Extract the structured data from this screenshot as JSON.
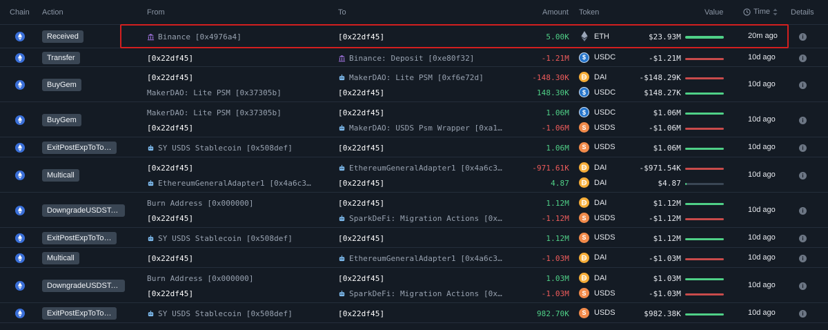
{
  "header": {
    "chain": "Chain",
    "action": "Action",
    "from": "From",
    "to": "To",
    "amount": "Amount",
    "token": "Token",
    "value": "Value",
    "time": "Time",
    "details": "Details"
  },
  "colors": {
    "background": "#141b24",
    "positive": "#4fd087",
    "negative": "#ef5b5b",
    "highlight": "#d41f1f",
    "badge": "#3a4654"
  },
  "rows": [
    {
      "action": "Received",
      "time": "20m ago",
      "lines": [
        {
          "from": "Binance [0x4976a4]",
          "from_icon": "bank-icon",
          "to": "[0x22df45]",
          "to_icon": "",
          "amount": "5.00K",
          "dir": "pos",
          "token": "ETH",
          "token_icon": "eth-icon",
          "value": "$23.93M",
          "level": 1.0
        }
      ]
    },
    {
      "action": "Transfer",
      "time": "10d ago",
      "lines": [
        {
          "from": "[0x22df45]",
          "from_icon": "",
          "to": "Binance: Deposit [0xe80f32]",
          "to_icon": "bank-icon",
          "amount": "-1.21M",
          "dir": "neg",
          "token": "USDC",
          "token_icon": "usdc-icon",
          "value": "-$1.21M",
          "level": 1.0
        }
      ]
    },
    {
      "action": "BuyGem",
      "time": "10d ago",
      "lines": [
        {
          "from": "[0x22df45]",
          "from_icon": "",
          "to": "MakerDAO: Lite PSM [0xf6e72d]",
          "to_icon": "bot-icon",
          "amount": "-148.30K",
          "dir": "neg",
          "token": "DAI",
          "token_icon": "dai-icon",
          "value": "-$148.29K",
          "level": 1.0
        },
        {
          "from": "MakerDAO: Lite PSM [0x37305b]",
          "from_icon": "",
          "to": "[0x22df45]",
          "to_icon": "",
          "amount": "148.30K",
          "dir": "pos",
          "token": "USDC",
          "token_icon": "usdc-icon",
          "value": "$148.27K",
          "level": 1.0
        }
      ]
    },
    {
      "action": "BuyGem",
      "time": "10d ago",
      "lines": [
        {
          "from": "MakerDAO: Lite PSM [0x37305b]",
          "from_icon": "",
          "to": "[0x22df45]",
          "to_icon": "",
          "amount": "1.06M",
          "dir": "pos",
          "token": "USDC",
          "token_icon": "usdc-icon",
          "value": "$1.06M",
          "level": 1.0
        },
        {
          "from": "[0x22df45]",
          "from_icon": "",
          "to": "MakerDAO: USDS Psm Wrapper [0xa1…",
          "to_icon": "bot-icon",
          "amount": "-1.06M",
          "dir": "neg",
          "token": "USDS",
          "token_icon": "usds-icon",
          "value": "-$1.06M",
          "level": 1.0
        }
      ]
    },
    {
      "action": "ExitPostExpToTo…",
      "time": "10d ago",
      "lines": [
        {
          "from": "SY USDS Stablecoin [0x508def]",
          "from_icon": "bot-icon",
          "to": "[0x22df45]",
          "to_icon": "",
          "amount": "1.06M",
          "dir": "pos",
          "token": "USDS",
          "token_icon": "usds-icon",
          "value": "$1.06M",
          "level": 1.0
        }
      ]
    },
    {
      "action": "Multicall",
      "time": "10d ago",
      "lines": [
        {
          "from": "[0x22df45]",
          "from_icon": "",
          "to": "EthereumGeneralAdapter1 [0x4a6c3…",
          "to_icon": "bot-icon",
          "amount": "-971.61K",
          "dir": "neg",
          "token": "DAI",
          "token_icon": "dai-icon",
          "value": "-$971.54K",
          "level": 1.0
        },
        {
          "from": "EthereumGeneralAdapter1 [0x4a6c3…",
          "from_icon": "bot-icon",
          "to": "[0x22df45]",
          "to_icon": "",
          "amount": "4.87",
          "dir": "pos",
          "token": "DAI",
          "token_icon": "dai-icon",
          "value": "$4.87",
          "level": 0.0
        }
      ]
    },
    {
      "action": "DowngradeUSDSTo…",
      "time": "10d ago",
      "lines": [
        {
          "from": "Burn Address [0x000000]",
          "from_icon": "",
          "to": "[0x22df45]",
          "to_icon": "",
          "amount": "1.12M",
          "dir": "pos",
          "token": "DAI",
          "token_icon": "dai-icon",
          "value": "$1.12M",
          "level": 1.0
        },
        {
          "from": "[0x22df45]",
          "from_icon": "",
          "to": "SparkDeFi: Migration Actions [0x…",
          "to_icon": "bot-icon",
          "amount": "-1.12M",
          "dir": "neg",
          "token": "USDS",
          "token_icon": "usds-icon",
          "value": "-$1.12M",
          "level": 1.0
        }
      ]
    },
    {
      "action": "ExitPostExpToTo…",
      "time": "10d ago",
      "lines": [
        {
          "from": "SY USDS Stablecoin [0x508def]",
          "from_icon": "bot-icon",
          "to": "[0x22df45]",
          "to_icon": "",
          "amount": "1.12M",
          "dir": "pos",
          "token": "USDS",
          "token_icon": "usds-icon",
          "value": "$1.12M",
          "level": 1.0
        }
      ]
    },
    {
      "action": "Multicall",
      "time": "10d ago",
      "lines": [
        {
          "from": "[0x22df45]",
          "from_icon": "",
          "to": "EthereumGeneralAdapter1 [0x4a6c3…",
          "to_icon": "bot-icon",
          "amount": "-1.03M",
          "dir": "neg",
          "token": "DAI",
          "token_icon": "dai-icon",
          "value": "-$1.03M",
          "level": 1.0
        }
      ]
    },
    {
      "action": "DowngradeUSDSTo…",
      "time": "10d ago",
      "lines": [
        {
          "from": "Burn Address [0x000000]",
          "from_icon": "",
          "to": "[0x22df45]",
          "to_icon": "",
          "amount": "1.03M",
          "dir": "pos",
          "token": "DAI",
          "token_icon": "dai-icon",
          "value": "$1.03M",
          "level": 1.0
        },
        {
          "from": "[0x22df45]",
          "from_icon": "",
          "to": "SparkDeFi: Migration Actions [0x…",
          "to_icon": "bot-icon",
          "amount": "-1.03M",
          "dir": "neg",
          "token": "USDS",
          "token_icon": "usds-icon",
          "value": "-$1.03M",
          "level": 1.0
        }
      ]
    },
    {
      "action": "ExitPostExpToTo…",
      "time": "10d ago",
      "lines": [
        {
          "from": "SY USDS Stablecoin [0x508def]",
          "from_icon": "bot-icon",
          "to": "[0x22df45]",
          "to_icon": "",
          "amount": "982.70K",
          "dir": "pos",
          "token": "USDS",
          "token_icon": "usds-icon",
          "value": "$982.38K",
          "level": 1.0
        }
      ]
    }
  ]
}
